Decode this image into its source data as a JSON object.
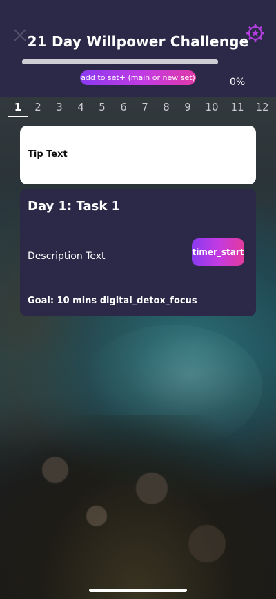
{
  "header": {
    "title": "21 Day Willpower Challenge",
    "add_to_set_label": "add to set+ (main or new set)",
    "progress_percent_text": "0%",
    "progress_fraction": 0
  },
  "tabs": {
    "active_index": 0,
    "items": [
      "1",
      "2",
      "3",
      "4",
      "5",
      "6",
      "7",
      "8",
      "9",
      "10",
      "11",
      "12"
    ]
  },
  "tip": {
    "text": "Tip Text"
  },
  "task": {
    "title": "Day 1: Task 1",
    "description": "Description Text",
    "timer_button_label": "timer_start",
    "goal": "Goal: 10 mins digital_detox_focus"
  },
  "icons": {
    "close": "close-icon",
    "settings": "gear-star-icon"
  },
  "colors": {
    "header_bg": "#2b2848",
    "accent_purple": "#8a3af0",
    "accent_pink": "#e03aa8",
    "progress_fill": "#d930a4"
  }
}
